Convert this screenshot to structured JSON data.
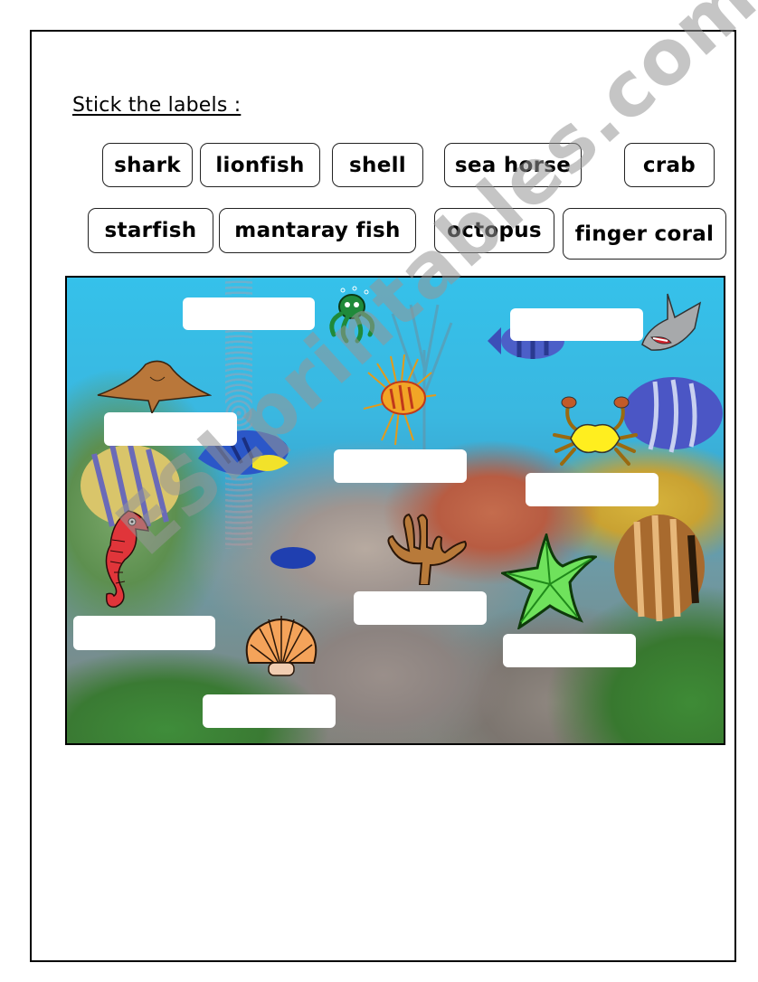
{
  "worksheet": {
    "instruction": "Stick the labels :",
    "word_bank": [
      {
        "label": "shark"
      },
      {
        "label": "lionfish"
      },
      {
        "label": "shell"
      },
      {
        "label": "sea horse"
      },
      {
        "label": "crab"
      },
      {
        "label": "starfish"
      },
      {
        "label": "mantaray fish"
      },
      {
        "label": "octopus"
      },
      {
        "label": "finger coral"
      }
    ],
    "scene": {
      "description": "underwater coral reef photo",
      "creatures": [
        "octopus",
        "mantaray fish",
        "lionfish",
        "shark",
        "crab",
        "sea horse",
        "finger coral",
        "starfish",
        "shell"
      ],
      "blank_label_count": 9
    },
    "watermark": "ESLprintables.com"
  },
  "colors": {
    "water": "#35c1ea",
    "label_border": "#222222",
    "blank_box": "#ffffff",
    "watermark": "#969696"
  }
}
